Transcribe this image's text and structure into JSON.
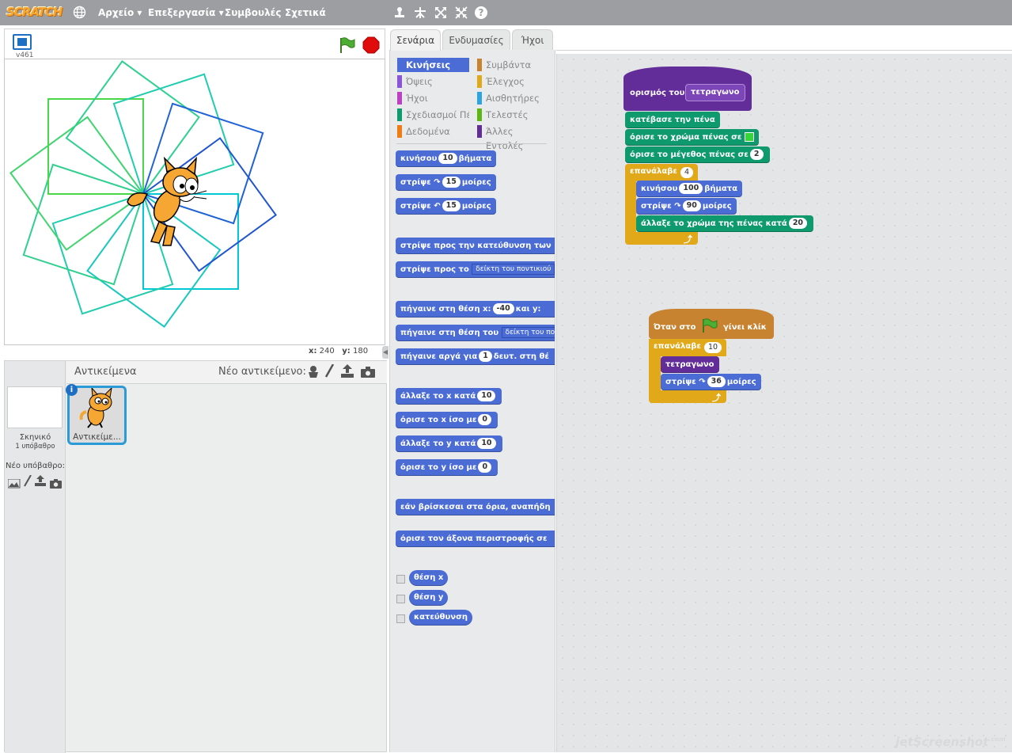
{
  "menubar": {
    "logo": "SCRATCH",
    "file": "Αρχείο ▾",
    "edit": "Επεξεργασία ▾",
    "tips": "Συμβουλές",
    "about": "Σχετικά",
    "help_icon": "?"
  },
  "stage": {
    "version": "v461",
    "x_label": "x:",
    "x_value": "240",
    "y_label": "y:",
    "y_value": "180"
  },
  "sprites": {
    "header": "Αντικείμενα",
    "new_sprite": "Νέο αντικείμενο:",
    "sprite1_name": "Αντικείμε...",
    "info_icon": "i"
  },
  "stage_panel": {
    "name": "Σκηνικό",
    "backdrops": "1 υπόβαθρο",
    "new_backdrop": "Νέο υπόβαθρο:"
  },
  "tabs": {
    "scripts": "Σενάρια",
    "costumes": "Ενδυμασίες",
    "sounds": "Ήχοι"
  },
  "categories": {
    "motion": "Κινήσεις",
    "looks": "Όψεις",
    "sound": "Ήχοι",
    "pen": "Σχεδιασμοί Πένα",
    "data": "Δεδομένα",
    "events": "Συμβάντα",
    "control": "Έλεγχος",
    "sensing": "Αισθητήρες",
    "operators": "Τελεστές",
    "more": "Άλλες Εντολές"
  },
  "palette": {
    "move": "κινήσου",
    "move_n": "10",
    "steps": "βήματα",
    "turn": "στρίψε",
    "turn_n": "15",
    "degrees": "μοίρες",
    "point_dir": "στρίψε προς την κατεύθυνση των",
    "point_to": "στρίψε προς το",
    "mouse_ptr": "δείκτη του ποντικιού",
    "goto_xy": "πήγαινε στη θέση x:",
    "goto_x_n": "-40",
    "and_y": "και y:",
    "goto_pos": "πήγαινε στη θέση του",
    "mouse_ptr2": "δείκτη του πο",
    "glide": "πήγαινε αργά για",
    "glide_n": "1",
    "glide_rest": "δευτ. στη θέ",
    "change_x": "άλλαξε το x κατά",
    "change_x_n": "10",
    "set_x": "όρισε το x ίσο με",
    "set_x_n": "0",
    "change_y": "άλλαξε το y κατά",
    "change_y_n": "10",
    "set_y": "όρισε το y ίσο με",
    "set_y_n": "0",
    "bounce": "εάν βρίσκεσαι στα όρια, αναπήδη",
    "rotation": "όρισε τον άξονα περιστροφής σε",
    "rep_x": "θέση x",
    "rep_y": "θέση y",
    "rep_dir": "κατεύθυνση"
  },
  "script1": {
    "define": "ορισμός του",
    "proc": "τετραγωνο",
    "pen_down": "κατέβασε την πένα",
    "set_color": "όρισε το χρώμα πένας σε",
    "set_size": "όρισε το μέγεθος πένας σε",
    "size_n": "2",
    "repeat": "επανάλαβε",
    "repeat_n": "4",
    "move": "κινήσου",
    "move_n": "100",
    "steps": "βήματα",
    "turn": "στρίψε",
    "turn_n": "90",
    "degrees": "μοίρες",
    "change_color": "άλλαξε το χρώμα της πένας κατά",
    "change_n": "20",
    "color_swatch": "#39d439"
  },
  "script2": {
    "when": "Όταν στο",
    "clicked": "γίνει κλίκ",
    "repeat": "επανάλαβε",
    "repeat_n": "10",
    "proc": "τετραγωνο",
    "turn": "στρίψε",
    "turn_n": "36",
    "degrees": "μοίρες"
  },
  "watermark": "jetScreenshot",
  "watermark_sup": ".com"
}
